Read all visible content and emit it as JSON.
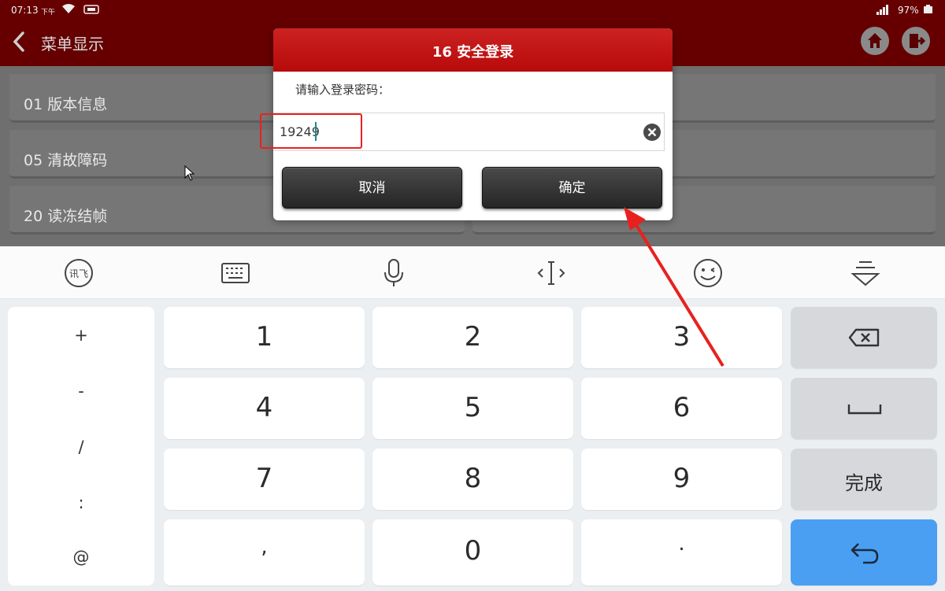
{
  "status_bar": {
    "time": "07:13",
    "ampm": "下午",
    "battery": "97%"
  },
  "header": {
    "title": "菜单显示",
    "back_icon": "chevron-left-icon",
    "home_icon": "home-icon",
    "exit_icon": "exit-icon"
  },
  "menu": {
    "items": [
      {
        "label": "01 版本信息"
      },
      {
        "label": "05 清故障码"
      },
      {
        "label": "20 读冻结帧"
      }
    ]
  },
  "dialog": {
    "title": "16 安全登录",
    "prompt": "请输入登录密码：",
    "password_value": "19249",
    "cancel_label": "取消",
    "confirm_label": "确定"
  },
  "keyboard": {
    "toolbar_icons": [
      "xunfei-logo-icon",
      "keyboard-icon",
      "microphone-icon",
      "cursor-move-icon",
      "emoji-icon",
      "hide-keyboard-icon"
    ],
    "xunfei_logo_text": "讯飞",
    "symbols": [
      "+",
      "-",
      "/",
      ":",
      "@"
    ],
    "digits": [
      "1",
      "2",
      "3",
      "4",
      "5",
      "6",
      "7",
      "8",
      "9",
      ",",
      "0",
      "."
    ],
    "done_label": "完成"
  },
  "colors": {
    "header_bg": "#660000",
    "dialog_title_bg": "#bf0f0f",
    "highlight": "#e8211f",
    "enter_key": "#4a9ff3"
  }
}
